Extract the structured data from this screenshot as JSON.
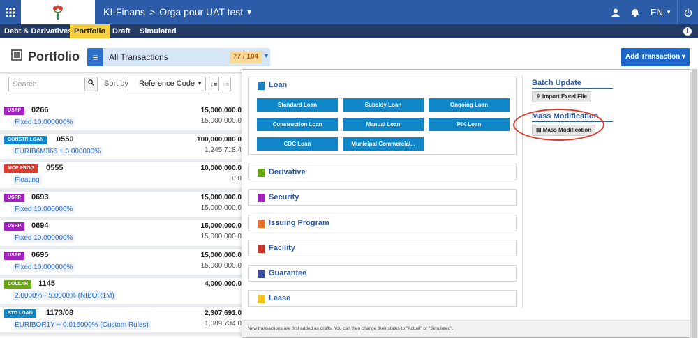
{
  "topbar": {
    "breadcrumb": [
      "KI-Finans",
      "Orga pour UAT test"
    ],
    "breadcrumb_sep": ">",
    "dropdown_caret": "▾",
    "language": "EN",
    "bg_color": "#2c5ca8"
  },
  "subnav": {
    "items": [
      "Debt & Derivatives ›",
      "Portfolio",
      "Draft",
      "Simulated"
    ],
    "active": "Portfolio",
    "info_glyph": "i"
  },
  "header": {
    "title": "Portfolio",
    "view_label": "All Transactions",
    "count": "77 / 104",
    "add_button": "Add Transaction ▾"
  },
  "toolbar": {
    "search_placeholder": "Search",
    "sort_by_label": "Sort by",
    "sort_value": "Reference Code"
  },
  "transactions": [
    {
      "tag": "USPP",
      "tag_color": "#a020c0",
      "code": "0266",
      "desc": "Fixed 10.000000%",
      "amount1": "15,000,000.0",
      "amount2": "15,000,000.0"
    },
    {
      "tag": "CONSTR LOAN",
      "tag_color": "#0e86c8",
      "code": "0550",
      "desc": "EURIB6M365 + 3.000000%",
      "amount1": "100,000,000.0",
      "amount2": "1,245,718.4"
    },
    {
      "tag": "MCP PROG",
      "tag_color": "#e03a2d",
      "code": "0555",
      "desc": "Floating",
      "amount1": "10,000,000.0",
      "amount2": "0.0"
    },
    {
      "tag": "USPP",
      "tag_color": "#a020c0",
      "code": "0693",
      "desc": "Fixed 10.000000%",
      "amount1": "15,000,000.0",
      "amount2": "15,000,000.0"
    },
    {
      "tag": "USPP",
      "tag_color": "#a020c0",
      "code": "0694",
      "desc": "Fixed 10.000000%",
      "amount1": "15,000,000.0",
      "amount2": "15,000,000.0"
    },
    {
      "tag": "USPP",
      "tag_color": "#a020c0",
      "code": "0695",
      "desc": "Fixed 10.000000%",
      "amount1": "15,000,000.0",
      "amount2": "15,000,000.0"
    },
    {
      "tag": "COLLAR",
      "tag_color": "#6aa811",
      "code": "1145",
      "desc": "2.0000% - 5.0000% (NIBOR1M)",
      "amount1": "4,000,000.0",
      "amount2": ""
    },
    {
      "tag": "STD LOAN",
      "tag_color": "#0e86c8",
      "code": "1173/08",
      "desc": "EURIBOR1Y + 0.016000% (Custom Rules)",
      "amount1": "2,307,691.0",
      "amount2": "1,089,734.0"
    }
  ],
  "popup": {
    "loan_label": "Loan",
    "loan_color": "#1a82c8",
    "loan_buttons": [
      "Standard Loan",
      "Subsidy Loan",
      "Ongoing Loan",
      "Construction Loan",
      "Manual Loan",
      "PIK Loan",
      "CDC Loan",
      "Municipal Commercial..."
    ],
    "categories": [
      {
        "label": "Derivative",
        "color": "#6aa811"
      },
      {
        "label": "Security",
        "color": "#a020c0"
      },
      {
        "label": "Issuing Program",
        "color": "#e8702a"
      },
      {
        "label": "Facility",
        "color": "#c8332b"
      },
      {
        "label": "Guarantee",
        "color": "#3b4aa0"
      },
      {
        "label": "Lease",
        "color": "#f5c21a"
      }
    ],
    "batch_update": {
      "heading": "Batch Update",
      "button": "Import Excel File"
    },
    "mass_modification": {
      "heading": "Mass Modification",
      "button": "Mass Modification"
    },
    "footer": "New transactions are first added as drafts. You can then change their status to \"Actual\" or \"Simulated\"."
  }
}
